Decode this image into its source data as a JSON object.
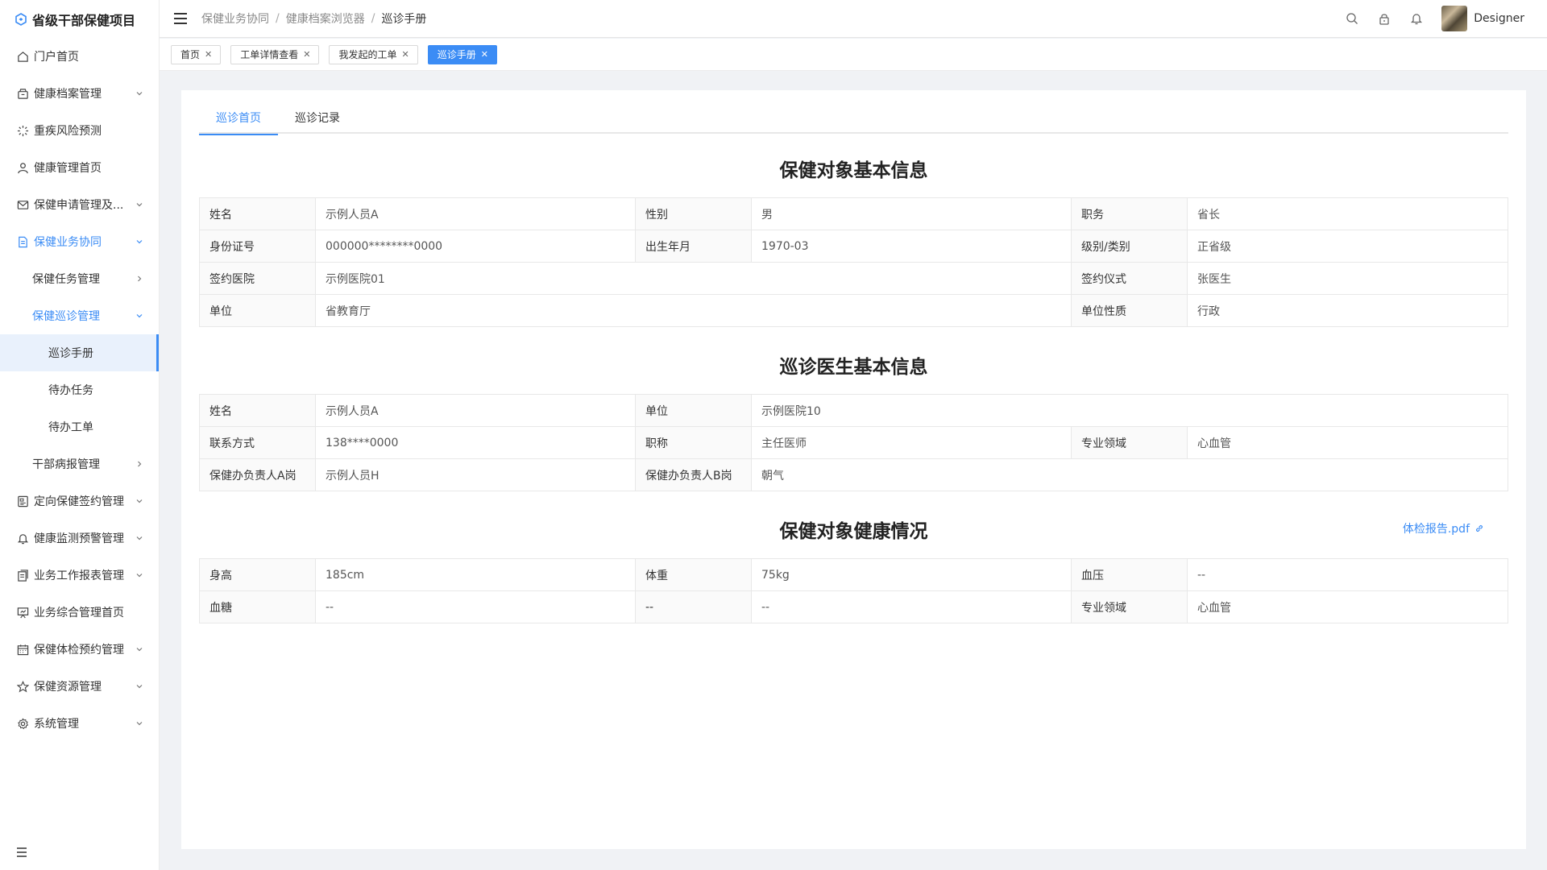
{
  "app": {
    "title": "省级干部保健项目"
  },
  "sidebar": {
    "items": [
      {
        "label": "门户首页",
        "icon": "home-icon",
        "arrow": ""
      },
      {
        "label": "健康档案管理",
        "icon": "archive-icon",
        "arrow": "down"
      },
      {
        "label": "重疾风险预测",
        "icon": "loading-icon",
        "arrow": ""
      },
      {
        "label": "健康管理首页",
        "icon": "user-icon",
        "arrow": ""
      },
      {
        "label": "保健申请管理及...",
        "icon": "mail-icon",
        "arrow": "down"
      },
      {
        "label": "保健业务协同",
        "icon": "document-icon",
        "arrow": "up"
      },
      {
        "label": "保健任务管理",
        "icon": "",
        "arrow": "right"
      },
      {
        "label": "保健巡诊管理",
        "icon": "",
        "arrow": "up"
      },
      {
        "label": "巡诊手册",
        "icon": "",
        "arrow": ""
      },
      {
        "label": "待办任务",
        "icon": "",
        "arrow": ""
      },
      {
        "label": "待办工单",
        "icon": "",
        "arrow": ""
      },
      {
        "label": "干部病报管理",
        "icon": "",
        "arrow": "right"
      },
      {
        "label": "定向保健签约管理",
        "icon": "contract-icon",
        "arrow": "down"
      },
      {
        "label": "健康监测预警管理",
        "icon": "bell-icon",
        "arrow": "down"
      },
      {
        "label": "业务工作报表管理",
        "icon": "report-icon",
        "arrow": "down"
      },
      {
        "label": "业务综合管理首页",
        "icon": "presentation-icon",
        "arrow": ""
      },
      {
        "label": "保健体检预约管理",
        "icon": "calendar-icon",
        "arrow": "down"
      },
      {
        "label": "保健资源管理",
        "icon": "star-icon",
        "arrow": "down"
      },
      {
        "label": "系统管理",
        "icon": "gear-icon",
        "arrow": "down"
      }
    ]
  },
  "header": {
    "breadcrumb": [
      "保健业务协同",
      "健康档案浏览器",
      "巡诊手册"
    ],
    "username": "Designer"
  },
  "tags": [
    {
      "label": "首页",
      "active": false
    },
    {
      "label": "工单详情查看",
      "active": false
    },
    {
      "label": "我发起的工单",
      "active": false
    },
    {
      "label": "巡诊手册",
      "active": true
    }
  ],
  "tabs": [
    {
      "label": "巡诊首页",
      "active": true
    },
    {
      "label": "巡诊记录",
      "active": false
    }
  ],
  "section1": {
    "title": "保健对象基本信息",
    "rows": [
      {
        "c": [
          "姓名",
          "示例人员A",
          "性别",
          "男",
          "职务",
          "省长"
        ]
      },
      {
        "c": [
          "身份证号",
          "000000********0000",
          "出生年月",
          "1970-03",
          "级别/类别",
          "正省级"
        ]
      },
      {
        "c": [
          "签约医院",
          "示例医院01",
          "签约仪式",
          "张医生"
        ]
      },
      {
        "c": [
          "单位",
          "省教育厅",
          "单位性质",
          "行政"
        ]
      }
    ]
  },
  "section2": {
    "title": "巡诊医生基本信息",
    "rows": [
      {
        "c": [
          "姓名",
          "示例人员A",
          "单位",
          "示例医院10"
        ]
      },
      {
        "c": [
          "联系方式",
          "138****0000",
          "职称",
          "主任医师",
          "专业领域",
          "心血管"
        ]
      },
      {
        "c": [
          "保健办负责人A岗",
          "示例人员H",
          "保健办负责人B岗",
          "朝气"
        ]
      }
    ]
  },
  "section3": {
    "title": "保健对象健康情况",
    "pdf_link": "体检报告.pdf",
    "rows": [
      {
        "c": [
          "身高",
          "185cm",
          "体重",
          "75kg",
          "血压",
          "--"
        ]
      },
      {
        "c": [
          "血糖",
          "--",
          "--",
          "--",
          "专业领域",
          "心血管"
        ]
      }
    ]
  }
}
